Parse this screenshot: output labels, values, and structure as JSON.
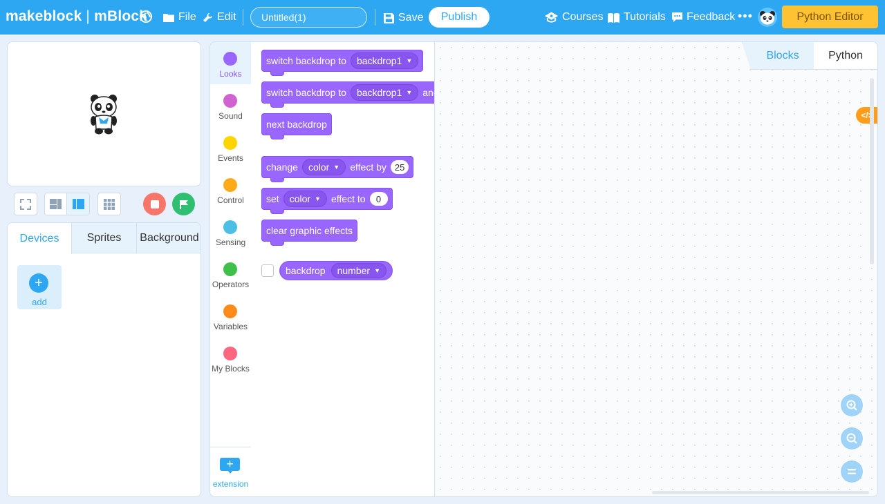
{
  "header": {
    "logo_brand": "makeblock",
    "logo_sep": "|",
    "logo_product": "mBlock",
    "file_label": "File",
    "edit_label": "Edit",
    "project_title": "Untitled(1)",
    "save_label": "Save",
    "publish_label": "Publish",
    "courses_label": "Courses",
    "tutorials_label": "Tutorials",
    "feedback_label": "Feedback",
    "more_label": "•••",
    "python_editor_label": "Python Editor"
  },
  "sprite_panel": {
    "tabs": [
      {
        "label": "Devices"
      },
      {
        "label": "Sprites"
      },
      {
        "label": "Background"
      }
    ],
    "add_label": "add"
  },
  "categories": [
    {
      "label": "Looks",
      "color": "#9966ff"
    },
    {
      "label": "Sound",
      "color": "#cf63cf"
    },
    {
      "label": "Events",
      "color": "#ffd500"
    },
    {
      "label": "Control",
      "color": "#ffab19"
    },
    {
      "label": "Sensing",
      "color": "#4cbfe6"
    },
    {
      "label": "Operators",
      "color": "#40bf4a"
    },
    {
      "label": "Variables",
      "color": "#ff8c1a"
    },
    {
      "label": "My Blocks",
      "color": "#ff6680"
    }
  ],
  "extension_label": "extension",
  "blocks": {
    "b1": {
      "text": "switch backdrop to",
      "dropdown": "backdrop1"
    },
    "b2": {
      "text": "switch backdrop to",
      "dropdown": "backdrop1",
      "suffix": "and"
    },
    "b3": {
      "text": "next backdrop"
    },
    "b4": {
      "text1": "change",
      "dropdown": "color",
      "text2": "effect by",
      "value": "25"
    },
    "b5": {
      "text1": "set",
      "dropdown": "color",
      "text2": "effect to",
      "value": "0"
    },
    "b6": {
      "text": "clear graphic effects"
    },
    "r1": {
      "text": "backdrop",
      "dropdown": "number"
    }
  },
  "workspace": {
    "tab_blocks": "Blocks",
    "tab_python": "Python",
    "code_toggle": "</>"
  },
  "colors": {
    "accent": "#2ea7f3",
    "looks": "#9966ff",
    "python_editor_bg": "#ffc233",
    "stop": "#f6766a",
    "go": "#2fbf71"
  },
  "icons": [
    "globe-icon",
    "folder-icon",
    "wrench-icon",
    "save-icon",
    "courses-icon",
    "tutorials-icon",
    "feedback-icon",
    "panda-avatar-icon",
    "fullscreen-icon",
    "small-stage-icon",
    "large-stage-icon",
    "grid-icon",
    "stop-icon",
    "green-flag-icon",
    "zoom-in-icon",
    "zoom-out-icon",
    "zoom-reset-icon"
  ]
}
